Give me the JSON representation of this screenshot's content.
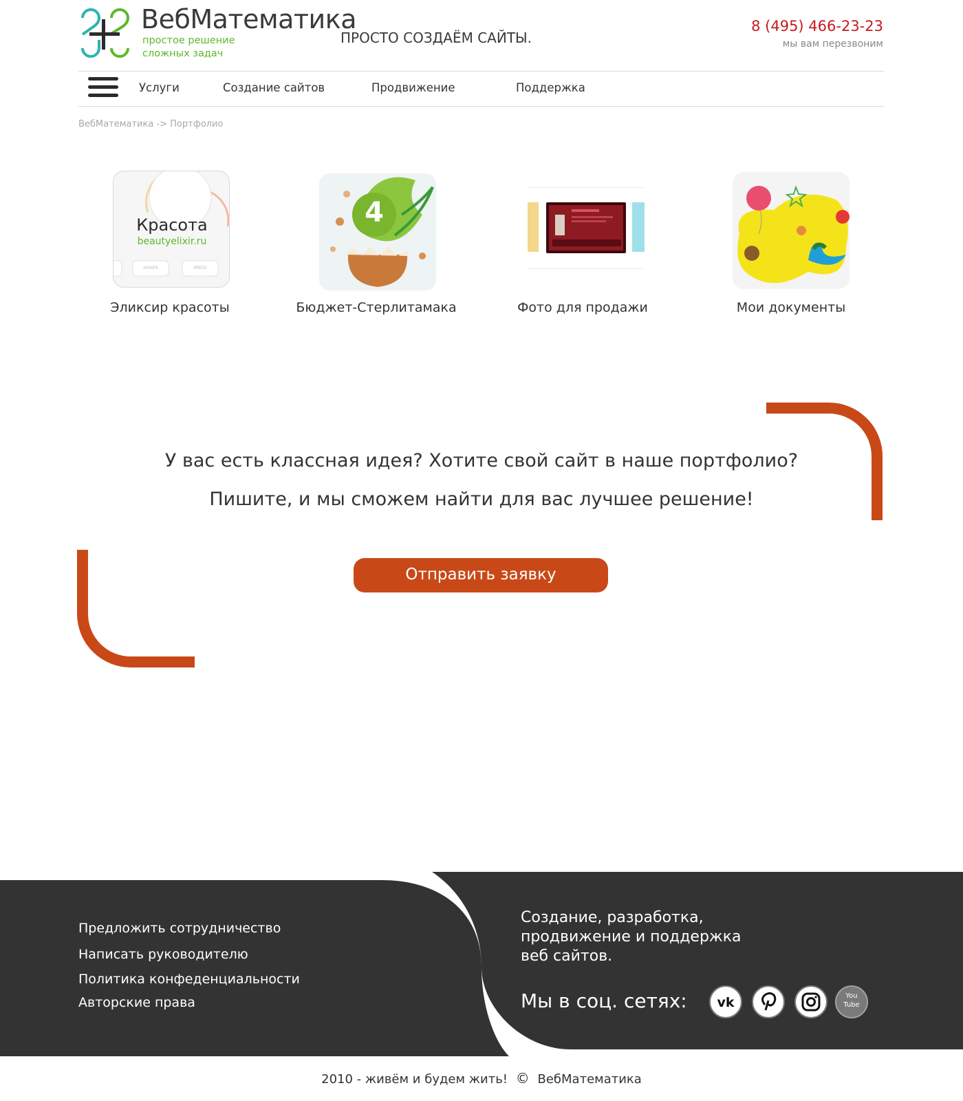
{
  "header": {
    "logo_title": "ВебМатематика",
    "logo_tagline_1": "простое решение",
    "logo_tagline_2": "сложных задач",
    "slogan": "ПРОСТО СОЗДАЁМ САЙТЫ.",
    "phone": "8 (495) 466-23-23",
    "callback": "мы вам перезвоним"
  },
  "nav": {
    "menu_icon": "hamburger-menu-icon",
    "items": [
      "Услуги",
      "Создание сайтов",
      "Продвижение",
      "Поддержка"
    ]
  },
  "breadcrumb": "ВебМатематика -> Портфолио",
  "portfolio": {
    "items": [
      {
        "caption": "Эликсир красоты",
        "thumb_title": "Красота",
        "thumb_url": "beautyelixir.ru",
        "thumb_btn_1": "HOVER",
        "thumb_btn_2": "PRESS"
      },
      {
        "caption": "Бюджет-Стерлитамака",
        "thumb_number": "4"
      },
      {
        "caption": "Фото для продажи"
      },
      {
        "caption": "Мои документы"
      }
    ]
  },
  "cta": {
    "line_1": "У вас есть классная идея? Хотите свой сайт в наше портфолио?",
    "line_2": "Пишите, и мы сможем найти для вас лучшее решение!",
    "button": "Отправить заявку",
    "accent_color": "#c84917"
  },
  "footer": {
    "links": [
      "Предложить сотрудничество",
      "Написать руководителю",
      "Политика конфеденциальности",
      "Авторские права"
    ],
    "description_lines": [
      "Создание, разработка,",
      "продвижение и поддержка",
      "веб сайтов."
    ],
    "social_label": "Мы в соц. сетях:",
    "social_icons": [
      "vk-icon",
      "pinterest-icon",
      "instagram-icon",
      "youtube-icon"
    ],
    "youtube_text_1": "You",
    "youtube_text_2": "Tube",
    "copyright_left": "2010 - живём и будем жить!",
    "copyright_symbol": "©",
    "copyright_right": "ВебМатематика",
    "background_color": "#333333"
  }
}
